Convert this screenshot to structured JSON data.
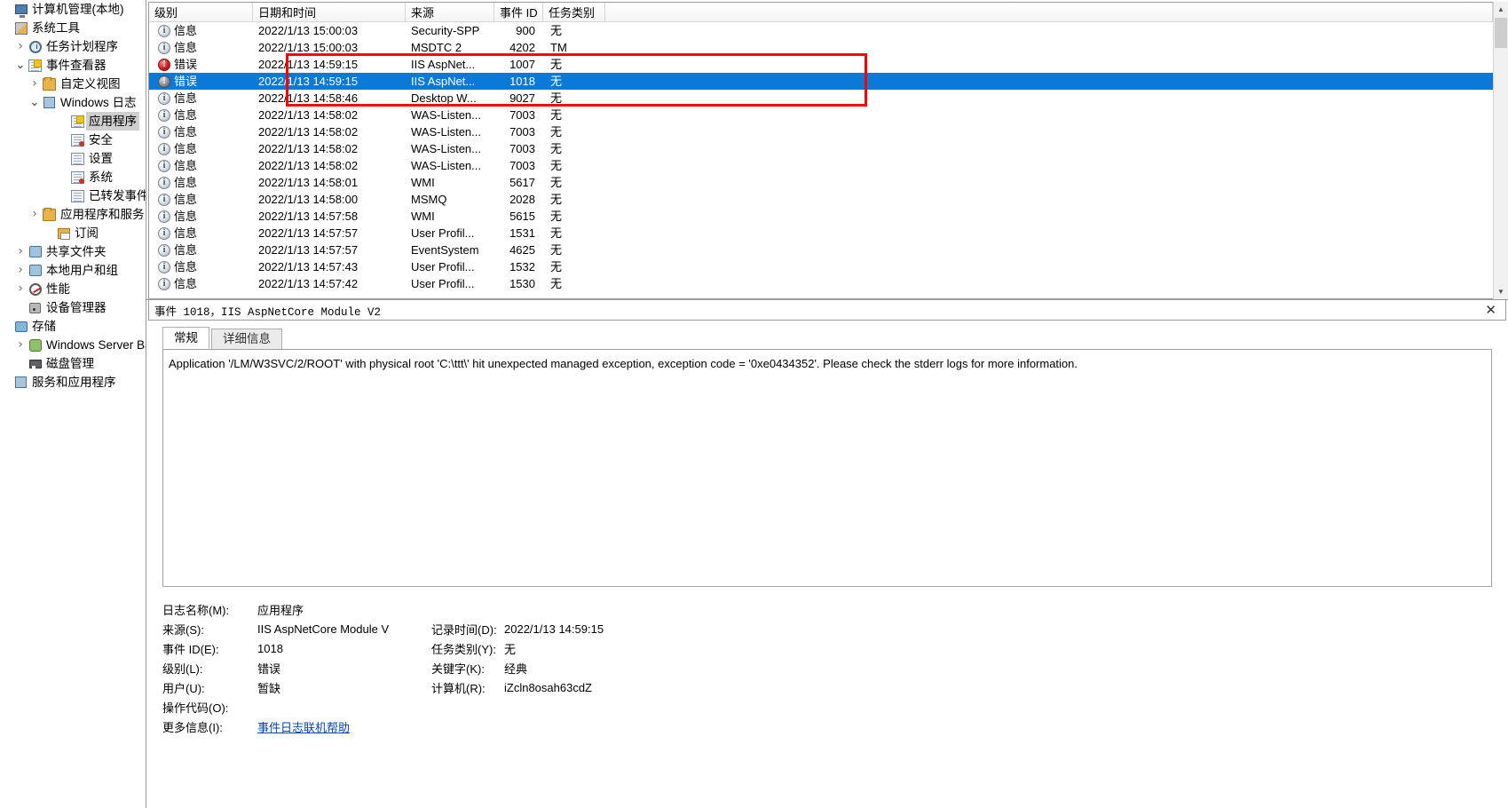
{
  "sidebar": {
    "items": [
      {
        "label": "计算机管理(本地)",
        "indent": 0,
        "chev": "",
        "icon": "computer-icon",
        "selected": false
      },
      {
        "label": "系统工具",
        "indent": 0,
        "chev": "",
        "icon": "tools-icon",
        "selected": false
      },
      {
        "label": "任务计划程序",
        "indent": 1,
        "chev": "collapsed",
        "icon": "clock-icon",
        "selected": false
      },
      {
        "label": "事件查看器",
        "indent": 1,
        "chev": "expanded",
        "icon": "event-viewer-icon",
        "selected": false
      },
      {
        "label": "自定义视图",
        "indent": 2,
        "chev": "collapsed",
        "icon": "custom-views-folder-icon",
        "selected": false
      },
      {
        "label": "Windows 日志",
        "indent": 2,
        "chev": "expanded",
        "icon": "windows-logs-folder-icon",
        "selected": false
      },
      {
        "label": "应用程序",
        "indent": 4,
        "chev": "",
        "icon": "log-application-icon",
        "selected": true
      },
      {
        "label": "安全",
        "indent": 4,
        "chev": "",
        "icon": "log-security-icon",
        "selected": false
      },
      {
        "label": "设置",
        "indent": 4,
        "chev": "",
        "icon": "log-setup-icon",
        "selected": false
      },
      {
        "label": "系统",
        "indent": 4,
        "chev": "",
        "icon": "log-system-icon",
        "selected": false
      },
      {
        "label": "已转发事件",
        "indent": 4,
        "chev": "",
        "icon": "log-forwarded-icon",
        "selected": false
      },
      {
        "label": "应用程序和服务日志",
        "indent": 2,
        "chev": "collapsed",
        "icon": "apps-services-folder-icon",
        "selected": false
      },
      {
        "label": "订阅",
        "indent": 3,
        "chev": "",
        "icon": "subscriptions-icon",
        "selected": false
      },
      {
        "label": "共享文件夹",
        "indent": 1,
        "chev": "collapsed",
        "icon": "shared-folders-icon",
        "selected": false
      },
      {
        "label": "本地用户和组",
        "indent": 1,
        "chev": "collapsed",
        "icon": "local-users-groups-icon",
        "selected": false
      },
      {
        "label": "性能",
        "indent": 1,
        "chev": "collapsed",
        "icon": "performance-icon",
        "selected": false
      },
      {
        "label": "设备管理器",
        "indent": 1,
        "chev": "",
        "icon": "device-manager-icon",
        "selected": false
      },
      {
        "label": "存储",
        "indent": 0,
        "chev": "",
        "icon": "storage-icon",
        "selected": false
      },
      {
        "label": "Windows Server Back",
        "indent": 1,
        "chev": "collapsed",
        "icon": "windows-server-backup-icon",
        "selected": false
      },
      {
        "label": "磁盘管理",
        "indent": 1,
        "chev": "",
        "icon": "disk-management-icon",
        "selected": false
      },
      {
        "label": "服务和应用程序",
        "indent": 0,
        "chev": "",
        "icon": "services-apps-icon",
        "selected": false
      }
    ]
  },
  "event_list": {
    "columns": [
      "级别",
      "日期和时间",
      "来源",
      "事件 ID",
      "任务类别"
    ],
    "rows": [
      {
        "level": "信息",
        "icon": "info-icon",
        "datetime": "2022/1/13 15:00:03",
        "source": "Security-SPP",
        "event_id": "900",
        "task": "无",
        "selected": false
      },
      {
        "level": "信息",
        "icon": "info-icon",
        "datetime": "2022/1/13 15:00:03",
        "source": "MSDTC 2",
        "event_id": "4202",
        "task": "TM",
        "selected": false
      },
      {
        "level": "错误",
        "icon": "error-icon",
        "datetime": "2022/1/13 14:59:15",
        "source": "IIS AspNet...",
        "event_id": "1007",
        "task": "无",
        "selected": false
      },
      {
        "level": "错误",
        "icon": "error-icon",
        "datetime": "2022/1/13 14:59:15",
        "source": "IIS AspNet...",
        "event_id": "1018",
        "task": "无",
        "selected": true
      },
      {
        "level": "信息",
        "icon": "info-icon",
        "datetime": "2022/1/13 14:58:46",
        "source": "Desktop W...",
        "event_id": "9027",
        "task": "无",
        "selected": false
      },
      {
        "level": "信息",
        "icon": "info-icon",
        "datetime": "2022/1/13 14:58:02",
        "source": "WAS-Listen...",
        "event_id": "7003",
        "task": "无",
        "selected": false
      },
      {
        "level": "信息",
        "icon": "info-icon",
        "datetime": "2022/1/13 14:58:02",
        "source": "WAS-Listen...",
        "event_id": "7003",
        "task": "无",
        "selected": false
      },
      {
        "level": "信息",
        "icon": "info-icon",
        "datetime": "2022/1/13 14:58:02",
        "source": "WAS-Listen...",
        "event_id": "7003",
        "task": "无",
        "selected": false
      },
      {
        "level": "信息",
        "icon": "info-icon",
        "datetime": "2022/1/13 14:58:02",
        "source": "WAS-Listen...",
        "event_id": "7003",
        "task": "无",
        "selected": false
      },
      {
        "level": "信息",
        "icon": "info-icon",
        "datetime": "2022/1/13 14:58:01",
        "source": "WMI",
        "event_id": "5617",
        "task": "无",
        "selected": false
      },
      {
        "level": "信息",
        "icon": "info-icon",
        "datetime": "2022/1/13 14:58:00",
        "source": "MSMQ",
        "event_id": "2028",
        "task": "无",
        "selected": false
      },
      {
        "level": "信息",
        "icon": "info-icon",
        "datetime": "2022/1/13 14:57:58",
        "source": "WMI",
        "event_id": "5615",
        "task": "无",
        "selected": false
      },
      {
        "level": "信息",
        "icon": "info-icon",
        "datetime": "2022/1/13 14:57:57",
        "source": "User Profil...",
        "event_id": "1531",
        "task": "无",
        "selected": false
      },
      {
        "level": "信息",
        "icon": "info-icon",
        "datetime": "2022/1/13 14:57:57",
        "source": "EventSystem",
        "event_id": "4625",
        "task": "无",
        "selected": false
      },
      {
        "level": "信息",
        "icon": "info-icon",
        "datetime": "2022/1/13 14:57:43",
        "source": "User Profil...",
        "event_id": "1532",
        "task": "无",
        "selected": false
      },
      {
        "level": "信息",
        "icon": "info-icon",
        "datetime": "2022/1/13 14:57:42",
        "source": "User Profil...",
        "event_id": "1530",
        "task": "无",
        "selected": false
      }
    ]
  },
  "annotation": {
    "color": "#ff0000",
    "shape": "rectangle"
  },
  "detail": {
    "title": "事件 1018，IIS AspNetCore Module V2",
    "close_label": "✕",
    "tabs": [
      {
        "label": "常规",
        "active": true
      },
      {
        "label": "详细信息",
        "active": false
      }
    ],
    "message": "Application '/LM/W3SVC/2/ROOT' with physical root 'C:\\ttt\\' hit unexpected managed exception, exception code = '0xe0434352'. Please check the stderr logs for more information.",
    "fields": [
      {
        "label": "日志名称(M):",
        "value": "应用程序",
        "label2": "",
        "value2": ""
      },
      {
        "label": "来源(S):",
        "value": "IIS AspNetCore Module V",
        "label2": "记录时间(D):",
        "value2": "2022/1/13 14:59:15"
      },
      {
        "label": "事件 ID(E):",
        "value": "1018",
        "label2": "任务类别(Y):",
        "value2": "无"
      },
      {
        "label": "级别(L):",
        "value": "错误",
        "label2": "关键字(K):",
        "value2": "经典"
      },
      {
        "label": "用户(U):",
        "value": "暂缺",
        "label2": "计算机(R):",
        "value2": "iZcln8osah63cdZ"
      },
      {
        "label": "操作代码(O):",
        "value": "",
        "label2": "",
        "value2": ""
      },
      {
        "label": "更多信息(I):",
        "value": "事件日志联机帮助",
        "value_is_link": true,
        "label2": "",
        "value2": ""
      }
    ]
  }
}
